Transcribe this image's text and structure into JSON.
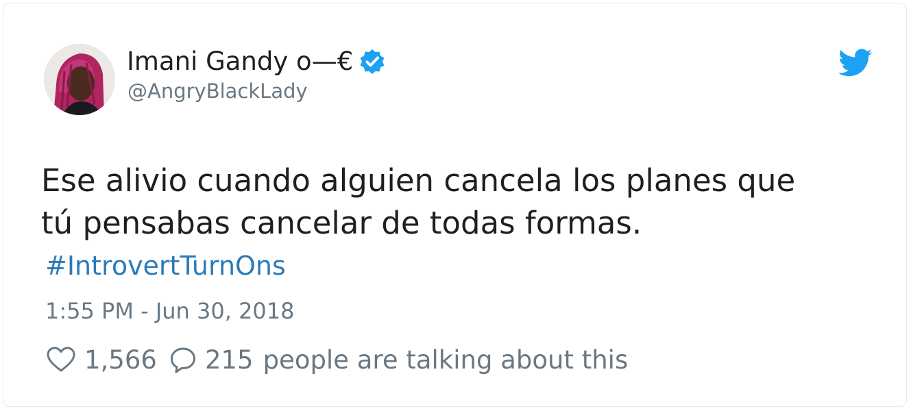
{
  "author": {
    "display_name": "Imani Gandy o—€",
    "handle": "@AngryBlackLady",
    "verified": true
  },
  "tweet": {
    "text_line1": "Ese alivio cuando alguien cancela los planes que",
    "text_line2": "tú pensabas cancelar de todas formas.",
    "hashtag": "#IntrovertTurnOns",
    "timestamp": "1:55 PM - Jun 30, 2018"
  },
  "engagement": {
    "likes": "1,566",
    "replies": "215",
    "talking_label": "people are talking about this"
  },
  "icons": {
    "brand": "twitter-bird-icon",
    "verified": "verified-badge-icon",
    "like": "heart-icon",
    "reply": "speech-bubble-icon"
  },
  "colors": {
    "brand_blue": "#1da1f2",
    "link_blue": "#2b7bb9",
    "text": "#1c2022",
    "muted": "#697882"
  }
}
